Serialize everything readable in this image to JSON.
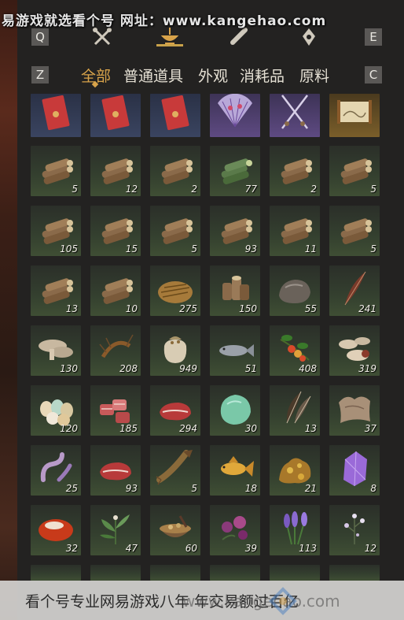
{
  "watermark_top": "易游戏就选看个号  网址：www.kangehao.com",
  "nav": {
    "left_key": "Q",
    "right_key": "E",
    "icons": [
      "crossed-tools-icon",
      "balance-pan-icon",
      "scroll-icon",
      "lantern-icon"
    ]
  },
  "tabs": {
    "left_key": "Z",
    "right_key": "C",
    "items": [
      {
        "label": "全部",
        "active": true
      },
      {
        "label": "普通道具",
        "active": false
      },
      {
        "label": "外观",
        "active": false
      },
      {
        "label": "消耗品",
        "active": false
      },
      {
        "label": "原料",
        "active": false
      }
    ]
  },
  "items": [
    {
      "icon": "red-envelope-icon",
      "qty": ""
    },
    {
      "icon": "red-envelope-icon",
      "qty": ""
    },
    {
      "icon": "red-envelope-icon",
      "qty": ""
    },
    {
      "icon": "folding-fan-icon",
      "qty": ""
    },
    {
      "icon": "crossed-blades-icon",
      "qty": ""
    },
    {
      "icon": "scroll-painting-icon",
      "qty": ""
    },
    {
      "icon": "log-pile-icon",
      "qty": "5"
    },
    {
      "icon": "log-pile-icon",
      "qty": "12"
    },
    {
      "icon": "log-pile-icon",
      "qty": "2"
    },
    {
      "icon": "green-log-pile-icon",
      "qty": "77"
    },
    {
      "icon": "log-pile-icon",
      "qty": "2"
    },
    {
      "icon": "log-pile-icon",
      "qty": "5"
    },
    {
      "icon": "log-pile-icon",
      "qty": "105"
    },
    {
      "icon": "log-pile-icon",
      "qty": "15"
    },
    {
      "icon": "log-pile-icon",
      "qty": "5"
    },
    {
      "icon": "log-pile-icon",
      "qty": "93"
    },
    {
      "icon": "log-pile-icon",
      "qty": "11"
    },
    {
      "icon": "log-pile-icon",
      "qty": "5"
    },
    {
      "icon": "log-pile-icon",
      "qty": "13"
    },
    {
      "icon": "log-pile-icon",
      "qty": "10"
    },
    {
      "icon": "straw-bundle-icon",
      "qty": "275"
    },
    {
      "icon": "stump-pile-icon",
      "qty": "150"
    },
    {
      "icon": "stone-icon",
      "qty": "55"
    },
    {
      "icon": "feather-icon",
      "qty": "241"
    },
    {
      "icon": "mushroom-icon",
      "qty": "130"
    },
    {
      "icon": "shrimp-icon",
      "qty": "208"
    },
    {
      "icon": "grain-sack-icon",
      "qty": "949"
    },
    {
      "icon": "fish-icon",
      "qty": "51"
    },
    {
      "icon": "berry-branch-icon",
      "qty": "408"
    },
    {
      "icon": "mushroom-cluster-icon",
      "qty": "319"
    },
    {
      "icon": "eggs-icon",
      "qty": "120"
    },
    {
      "icon": "meat-chunks-icon",
      "qty": "185"
    },
    {
      "icon": "meat-slab-icon",
      "qty": "294"
    },
    {
      "icon": "jade-stone-icon",
      "qty": "30"
    },
    {
      "icon": "feathers-icon",
      "qty": "13"
    },
    {
      "icon": "animal-hide-icon",
      "qty": "37"
    },
    {
      "icon": "worm-icon",
      "qty": "25"
    },
    {
      "icon": "meat-slab-icon",
      "qty": "93"
    },
    {
      "icon": "catfish-icon",
      "qty": "5"
    },
    {
      "icon": "golden-carp-icon",
      "qty": "18"
    },
    {
      "icon": "gold-ore-icon",
      "qty": "21"
    },
    {
      "icon": "amethyst-icon",
      "qty": "8"
    },
    {
      "icon": "red-gem-icon",
      "qty": "32"
    },
    {
      "icon": "herb-plant-icon",
      "qty": "47"
    },
    {
      "icon": "herb-bowl-icon",
      "qty": "60"
    },
    {
      "icon": "purple-flowers-icon",
      "qty": "39"
    },
    {
      "icon": "lavender-icon",
      "qty": "113"
    },
    {
      "icon": "small-flowers-icon",
      "qty": "12"
    }
  ],
  "watermark_bottom": "看个号专业网易游戏八年 年交易额过百亿",
  "watermark_bottom_url": "www.kangehao.com",
  "colors": {
    "accent": "#d8a34a",
    "slot_green": "#3f4e34",
    "qty_text": "#f2efe8"
  }
}
